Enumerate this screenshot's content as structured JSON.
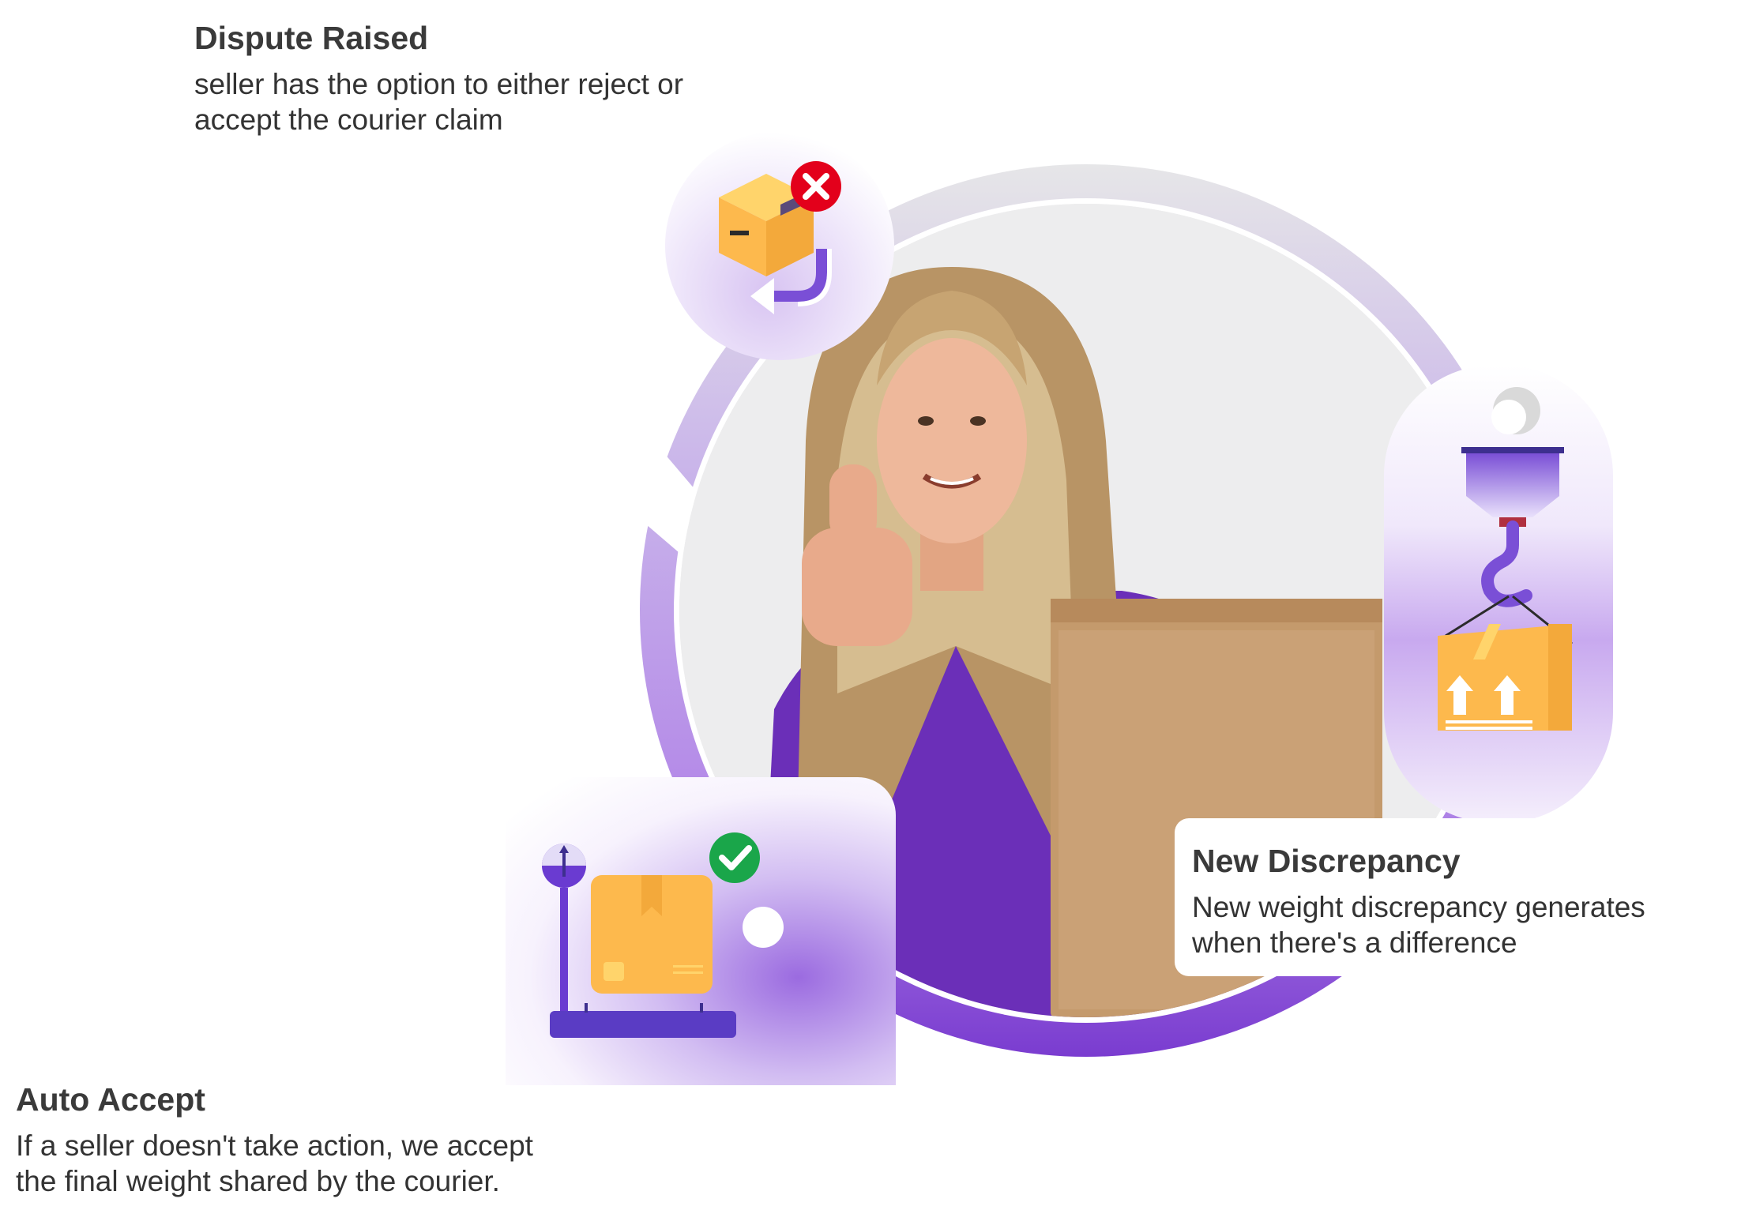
{
  "callouts": {
    "dispute": {
      "title": "Dispute Raised",
      "line1": "seller has the option to either reject or",
      "line2": "accept the courier claim"
    },
    "auto": {
      "title": "Auto Accept",
      "line1": "If a seller doesn't take action, we accept",
      "line2": "the final weight shared by the courier."
    },
    "new_discrepancy": {
      "title": "New Discrepancy",
      "line1": "New weight discrepancy generates",
      "line2": "when there's a difference"
    }
  },
  "colors": {
    "ring_top": "#e4e4e6",
    "ring_bottom": "#7b3fd0",
    "accent_purple": "#6a3bd1",
    "box_orange": "#fdb94d",
    "reject_red": "#e3001b",
    "accept_green": "#1aa64a"
  },
  "icons": {
    "dispute": "rejected-package-return-icon",
    "crane": "crane-lifting-package-icon",
    "scale": "weighing-scale-package-accepted-icon"
  }
}
